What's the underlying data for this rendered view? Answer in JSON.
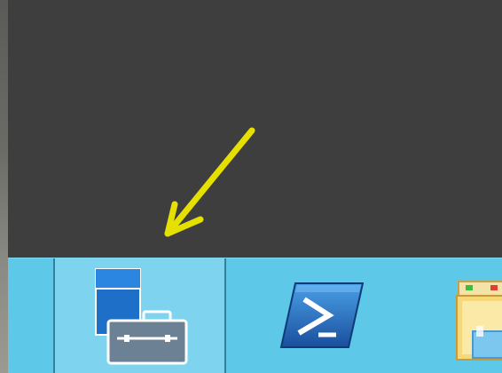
{
  "taskbar": {
    "items": [
      {
        "name": "server-manager",
        "icon": "server-manager-icon",
        "active": true
      },
      {
        "name": "powershell",
        "icon": "powershell-icon",
        "active": false
      },
      {
        "name": "file-explorer",
        "icon": "folder-icon",
        "active": false
      }
    ]
  },
  "annotation": {
    "arrow_color": "#e6e000"
  },
  "colors": {
    "taskbar": "#5ec8e8",
    "active_button": "#7ed4ef",
    "desktop": "#3e3e3e"
  }
}
